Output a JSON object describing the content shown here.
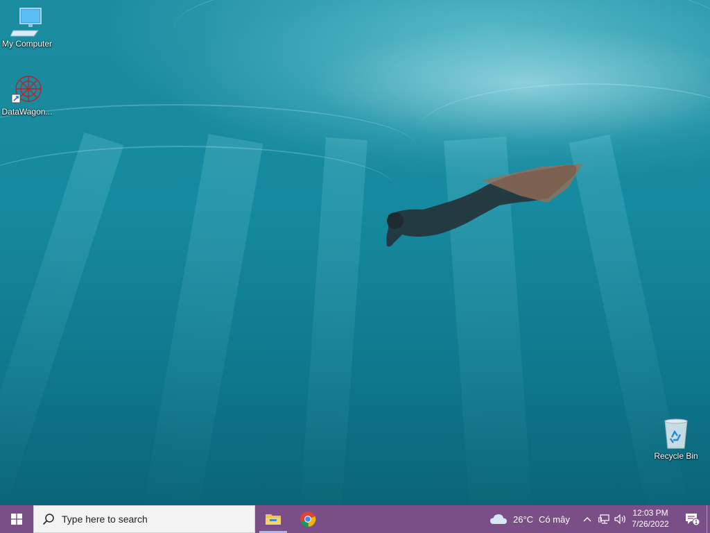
{
  "desktop": {
    "icons": [
      {
        "label": "My Computer",
        "icon": "computer-icon"
      },
      {
        "label": "DataWagon...",
        "icon": "datawagon-shortcut-icon"
      },
      {
        "label": "Recycle Bin",
        "icon": "recycle-bin-icon"
      }
    ]
  },
  "taskbar": {
    "start_icon": "windows-logo-icon",
    "search_placeholder": "Type here to search",
    "apps": [
      {
        "name": "File Explorer",
        "icon": "file-explorer-icon",
        "active": true
      },
      {
        "name": "Google Chrome",
        "icon": "chrome-icon",
        "active": false
      }
    ],
    "weather": {
      "temperature": "26°C",
      "condition": "Có mây",
      "icon": "cloud-icon"
    },
    "tray_icons": [
      "chevron-up-icon",
      "network-icon",
      "volume-icon"
    ],
    "clock": {
      "time": "12:03 PM",
      "date": "7/26/2022"
    },
    "notifications": {
      "count": "1",
      "icon": "notification-icon"
    }
  },
  "colors": {
    "taskbar": "#7a4f87",
    "search_bg": "#f3f3f3",
    "active_indicator": "#a9b8e6"
  }
}
